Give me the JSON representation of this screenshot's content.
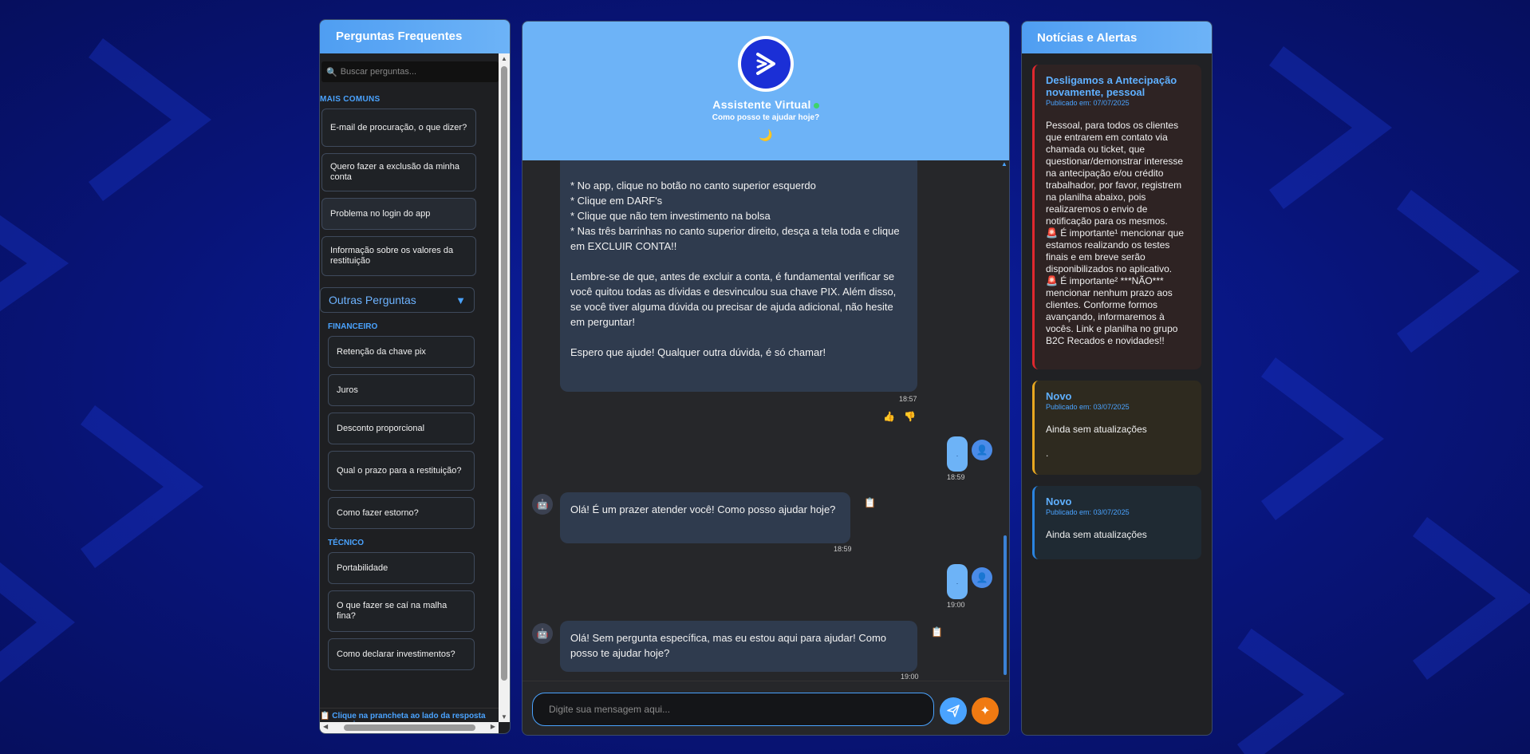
{
  "colors": {
    "background": "#0a1a8c",
    "accent": "#4aa3ff",
    "header": "#6db3f7",
    "bot_bubble": "#2f3b4e",
    "send_button": "#4aa3ff",
    "magic_button": "#f07a12"
  },
  "faq": {
    "title": "Perguntas Frequentes",
    "search_placeholder": "Buscar perguntas...",
    "section_common": "MAIS COMUNS",
    "common": [
      "E-mail de procuração, o que dizer?",
      "Quero fazer a exclusão da minha conta",
      "Problema no login do app",
      "Informação sobre os valores da restituição"
    ],
    "others_label": "Outras Perguntas",
    "financeiro_label": "FINANCEIRO",
    "financeiro": [
      "Retenção da chave pix",
      "Juros",
      "Desconto proporcional",
      "Qual o prazo para a restituição?",
      "Como fazer estorno?"
    ],
    "tecnico_label": "TÉCNICO",
    "tecnico": [
      "Portabilidade",
      "O que fazer se caí na malha fina?",
      "Como declarar investimentos?"
    ],
    "footer": "📋 Clique na prancheta ao lado da resposta para copiar"
  },
  "chat": {
    "title": "Assistente Virtual",
    "subtitle": "Como posso te ajudar hoje?",
    "moon": "🌙",
    "messages": [
      {
        "lines": [
          "* No app, clique no botão no canto superior esquerdo",
          "* Clique em DARF's",
          "* Clique que não tem investimento na bolsa",
          "* Nas três barrinhas no canto superior direito, desça a tela toda e clique em EXCLUIR CONTA!!",
          "",
          "Lembre-se de que, antes de excluir a conta, é fundamental verificar se você quitou todas as dívidas e desvinculou sua chave PIX. Além disso, se você tiver alguma dúvida ou precisar de ajuda adicional, não hesite em perguntar!",
          "",
          "Espero que ajude! Qualquer outra dúvida, é só chamar!"
        ],
        "time": "18:57"
      },
      {
        "user_text": ".",
        "time": "18:59"
      },
      {
        "text": "Olá! É um prazer atender você! Como posso ajudar hoje?",
        "time": "18:59"
      },
      {
        "user_text": ".",
        "time": "19:00"
      },
      {
        "text": "Olá! Sem pergunta específica, mas eu estou aqui para ajudar! Como posso te ajudar hoje?",
        "time": "19:00"
      }
    ],
    "input_placeholder": "Digite sua mensagem aqui..."
  },
  "news": {
    "title": "Notícias e Alertas",
    "cards": [
      {
        "title": "Desligamos a Antecipação novamente, pessoal",
        "date": "Publicado em: 07/07/2025",
        "text": "Pessoal, para todos os clientes que entrarem em contato via chamada ou ticket, que questionar/demonstrar interesse na antecipação e/ou crédito trabalhador, por favor, registrem na planilha abaixo, pois realizaremos o envio de notificação para os mesmos.\n🚨 É importante¹ mencionar que estamos realizando os testes finais e em breve serão disponibilizados no aplicativo.\n🚨 É importante² ***NÃO*** mencionar nenhum prazo aos clientes. Conforme formos avançando, informaremos à vocês. Link e planilha no grupo B2C Recados e novidades!!"
      },
      {
        "title": "Novo",
        "date": "Publicado em: 03/07/2025",
        "text": "Ainda sem atualizações\n\n."
      },
      {
        "title": "Novo",
        "date": "Publicado em: 03/07/2025",
        "text": "Ainda sem atualizações"
      }
    ]
  }
}
